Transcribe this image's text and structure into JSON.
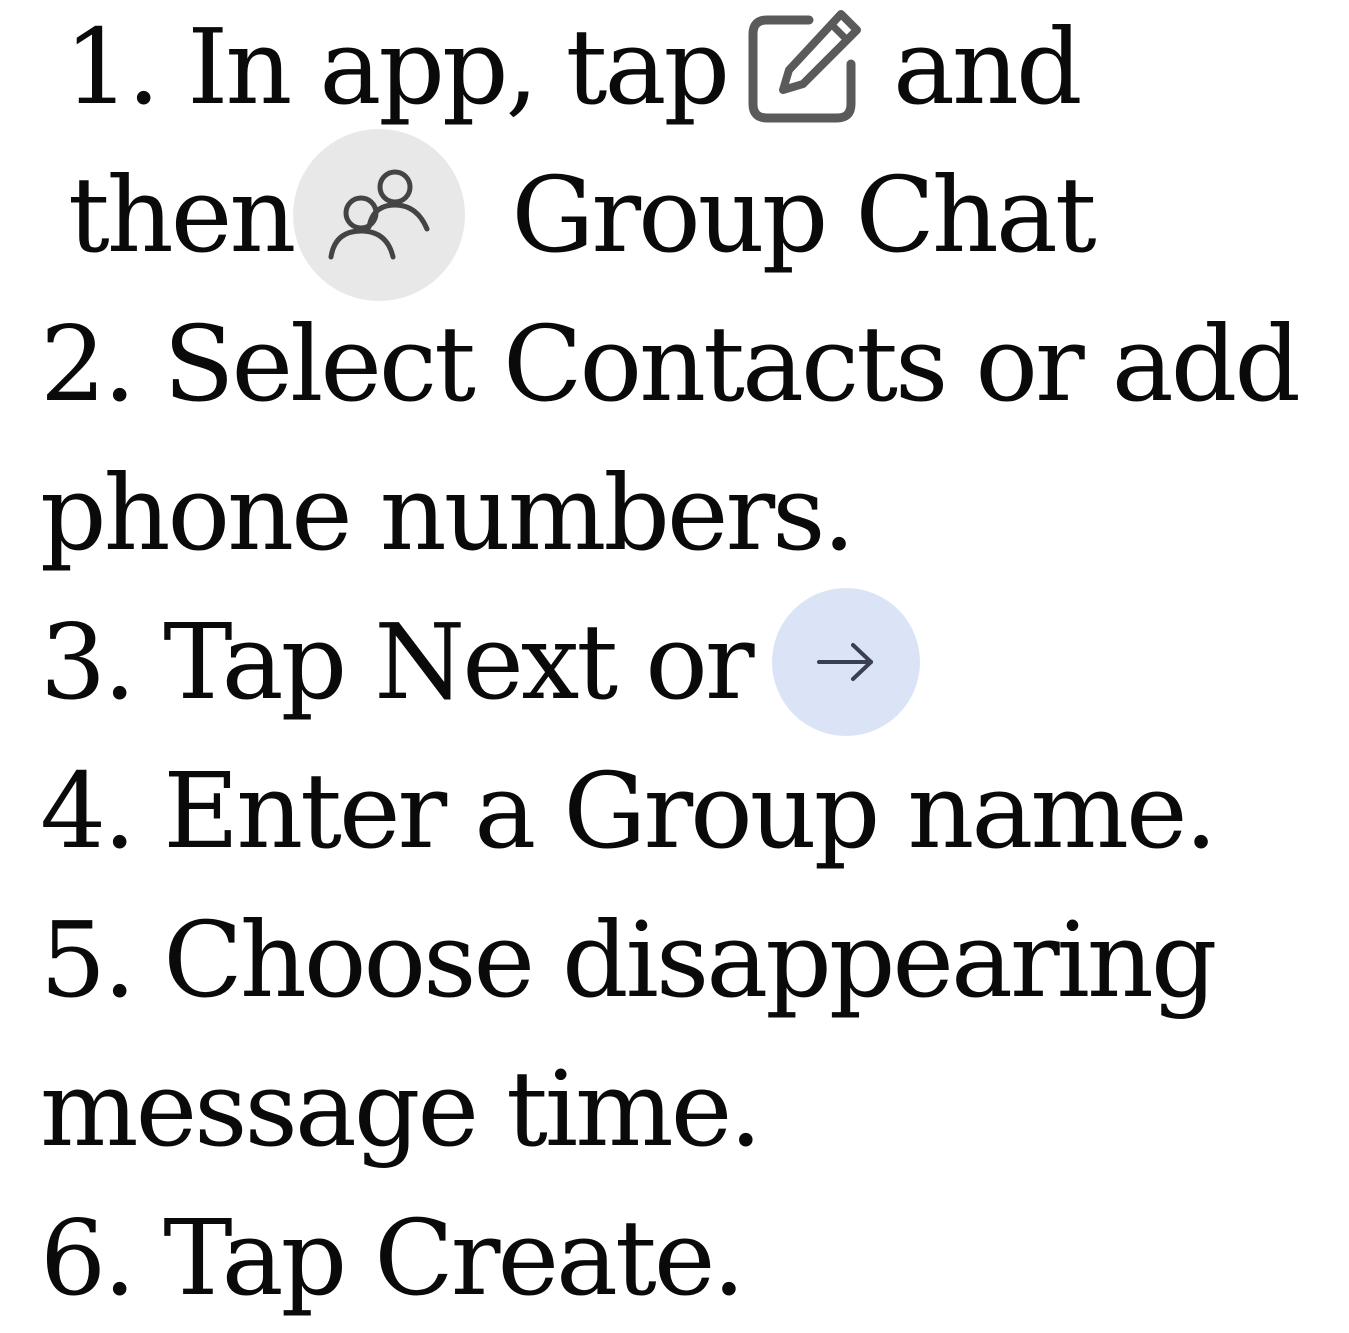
{
  "steps": {
    "s1_a": "1. In app, tap",
    "s1_b": "and",
    "s1_c": "then",
    "s1_d": "Group Chat",
    "s2_a": "2. Select Contacts or add",
    "s2_b": "phone numbers.",
    "s3": "3. Tap Next or",
    "s4": "4. Enter a Group name.",
    "s5_a": "5. Choose disappearing",
    "s5_b": "message time.",
    "s6": "6. Tap Create."
  },
  "icons": {
    "compose": "pencil-square-icon",
    "group": "group-people-icon",
    "next": "arrow-right-icon"
  },
  "colors": {
    "text": "#0a0a0a",
    "icon_stroke": "#555555",
    "group_icon_bg": "#e8e8e8",
    "next_icon_bg": "#dbe4f7"
  }
}
